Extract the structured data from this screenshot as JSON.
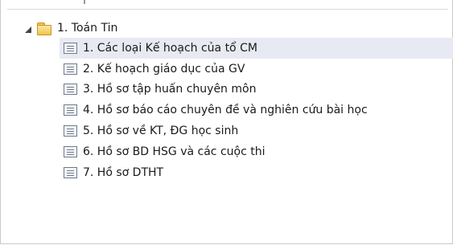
{
  "tree": {
    "root": {
      "label": "1. Toán Tin",
      "icon": "folder-icon",
      "expanded": true
    },
    "items": [
      {
        "label": "1. Các loại Kế hoạch của tổ CM",
        "icon": "document-list-icon",
        "selected": true
      },
      {
        "label": "2. Kế hoạch giáo dục của GV",
        "icon": "document-list-icon"
      },
      {
        "label": "3. Hồ sơ tập huấn chuyên môn",
        "icon": "document-list-icon"
      },
      {
        "label": "4. Hồ sơ báo cáo chuyên đề và nghiên cứu bài học",
        "icon": "document-list-icon"
      },
      {
        "label": "5. Hồ sơ về KT, ĐG học sinh",
        "icon": "document-list-icon"
      },
      {
        "label": "6. Hồ sơ BD HSG và các cuộc thi",
        "icon": "document-list-icon"
      },
      {
        "label": "7. Hồ sơ DTHT",
        "icon": "document-list-icon"
      }
    ]
  },
  "colors": {
    "selection": "#e8eaf3",
    "folder": "#f2c44f",
    "border": "#c9c9c9"
  }
}
